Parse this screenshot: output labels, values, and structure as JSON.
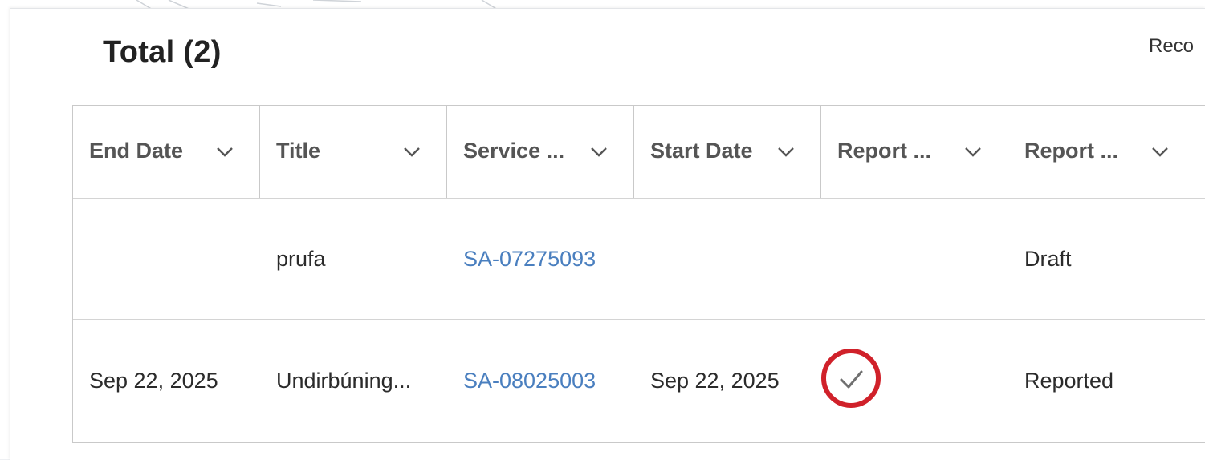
{
  "header": {
    "title": "Total (2)",
    "corner_link": "Reco"
  },
  "table": {
    "columns": [
      {
        "label": "End Date"
      },
      {
        "label": "Title"
      },
      {
        "label": "Service ..."
      },
      {
        "label": "Start Date"
      },
      {
        "label": "Report ..."
      },
      {
        "label": "Report ..."
      }
    ],
    "rows": [
      {
        "end_date": "",
        "title": "prufa",
        "service": "SA-07275093",
        "start_date": "",
        "reported_check": false,
        "status": "Draft"
      },
      {
        "end_date": "Sep 22, 2025",
        "title": "Undirbúning...",
        "service": "SA-08025003",
        "start_date": "Sep 22, 2025",
        "reported_check": true,
        "status": "Reported"
      }
    ]
  },
  "colors": {
    "link": "#4a7fbf",
    "highlight_circle": "#d0212a",
    "header_text": "#555555"
  },
  "icons": {
    "sort_chevron": "chevron-down-icon",
    "row_check": "checkmark-icon"
  }
}
